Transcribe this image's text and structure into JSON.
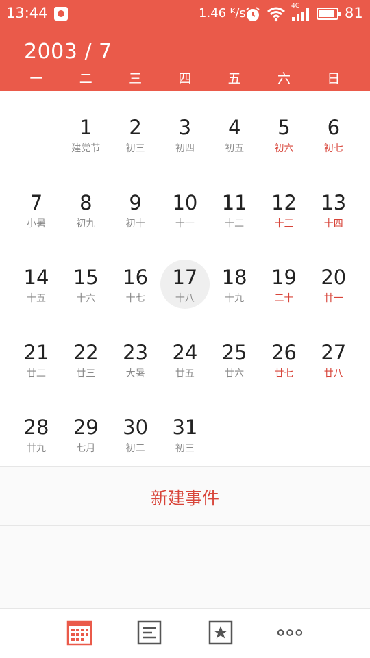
{
  "status_bar": {
    "time": "13:44",
    "net_speed": "1.46 ᴷ/s",
    "network_type": "4G",
    "battery": "81",
    "icons": [
      "app-notification-icon",
      "alarm-icon",
      "wifi-icon",
      "signal-icon",
      "battery-icon"
    ]
  },
  "header": {
    "title": "2003 / 7",
    "weekdays": [
      "一",
      "二",
      "三",
      "四",
      "五",
      "六",
      "日"
    ]
  },
  "calendar": {
    "selected_day": "17",
    "days": [
      {
        "n": "1",
        "l": "建党节"
      },
      {
        "n": "2",
        "l": "初三"
      },
      {
        "n": "3",
        "l": "初四"
      },
      {
        "n": "4",
        "l": "初五"
      },
      {
        "n": "5",
        "l": "初六"
      },
      {
        "n": "6",
        "l": "初七"
      },
      {
        "n": "7",
        "l": "小暑"
      },
      {
        "n": "8",
        "l": "初九"
      },
      {
        "n": "9",
        "l": "初十"
      },
      {
        "n": "10",
        "l": "十一"
      },
      {
        "n": "11",
        "l": "十二"
      },
      {
        "n": "12",
        "l": "十三"
      },
      {
        "n": "13",
        "l": "十四"
      },
      {
        "n": "14",
        "l": "十五"
      },
      {
        "n": "15",
        "l": "十六"
      },
      {
        "n": "16",
        "l": "十七"
      },
      {
        "n": "17",
        "l": "十八"
      },
      {
        "n": "18",
        "l": "十九"
      },
      {
        "n": "19",
        "l": "二十"
      },
      {
        "n": "20",
        "l": "廿一"
      },
      {
        "n": "21",
        "l": "廿二"
      },
      {
        "n": "22",
        "l": "廿三"
      },
      {
        "n": "23",
        "l": "大暑"
      },
      {
        "n": "24",
        "l": "廿五"
      },
      {
        "n": "25",
        "l": "廿六"
      },
      {
        "n": "26",
        "l": "廿七"
      },
      {
        "n": "27",
        "l": "廿八"
      },
      {
        "n": "28",
        "l": "廿九"
      },
      {
        "n": "29",
        "l": "七月"
      },
      {
        "n": "30",
        "l": "初二"
      },
      {
        "n": "31",
        "l": "初三"
      }
    ]
  },
  "new_event": {
    "label": "新建事件"
  },
  "bottom_nav": {
    "items": [
      "calendar-icon",
      "agenda-list-icon",
      "favorites-star-icon",
      "more-icon"
    ]
  },
  "colors": {
    "accent": "#ea5a4a",
    "weekend_lunar": "#d8453a",
    "lunar_text": "#8a8a8a",
    "selected_bg": "#efefef"
  }
}
